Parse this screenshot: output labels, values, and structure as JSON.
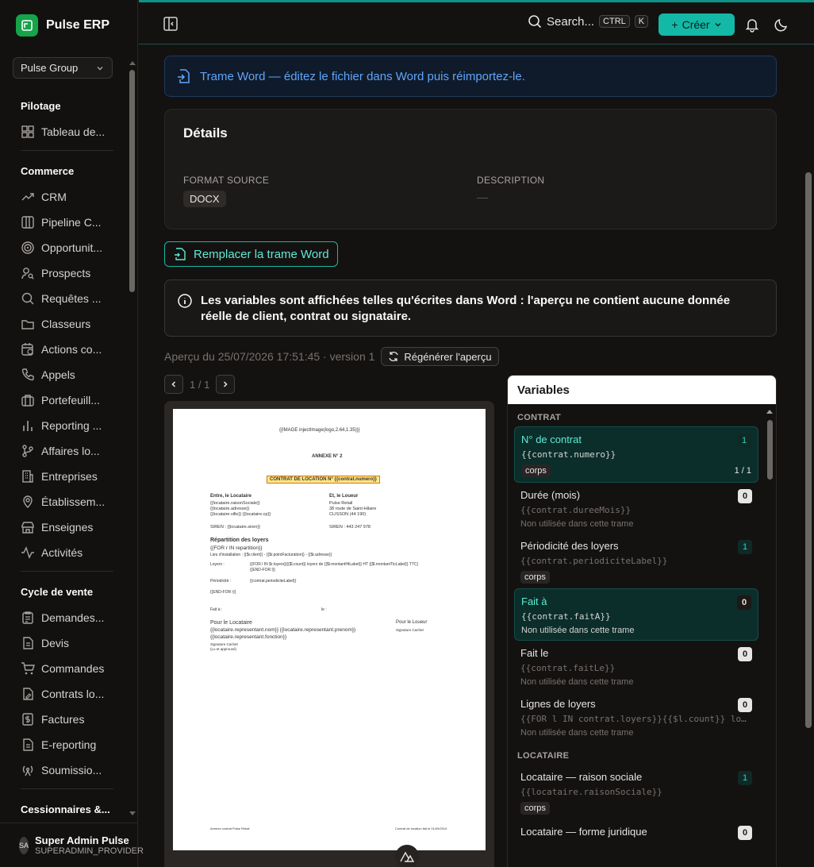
{
  "brand": {
    "name": "Pulse ERP"
  },
  "org": {
    "label": "Pulse Group"
  },
  "nav": {
    "pilotage": {
      "title": "Pilotage",
      "items": [
        "Tableau de..."
      ]
    },
    "commerce": {
      "title": "Commerce",
      "items": [
        "CRM",
        "Pipeline C...",
        "Opportunit...",
        "Prospects",
        "Requêtes ...",
        "Classeurs",
        "Actions co...",
        "Appels",
        "Portefeuill...",
        "Reporting ...",
        "Affaires lo...",
        "Entreprises",
        "Établissem...",
        "Enseignes",
        "Activités"
      ]
    },
    "cycle": {
      "title": "Cycle de vente",
      "items": [
        "Demandes...",
        "Devis",
        "Commandes",
        "Contrats lo...",
        "Factures",
        "E-reporting",
        "Soumissio..."
      ]
    },
    "cessionnaires": {
      "title": "Cessionnaires &..."
    }
  },
  "user": {
    "initials": "SA",
    "name": "Super Admin Pulse",
    "role": "SUPERADMIN_PROVIDER"
  },
  "topbar": {
    "search": "Search...",
    "kbd1": "CTRL",
    "kbd2": "K",
    "create": "Créer"
  },
  "banner": "Trame Word — éditez le fichier dans Word puis réimportez-le.",
  "details": {
    "title": "Détails",
    "format_label": "FORMAT SOURCE",
    "format_value": "DOCX",
    "desc_label": "DESCRIPTION",
    "desc_value": "—"
  },
  "replace_button": "Remplacer la trame Word",
  "info": "Les variables sont affichées telles qu'écrites dans Word : l'aperçu ne contient aucune donnée réelle de client, contrat ou signataire.",
  "preview": {
    "meta": "Aperçu du 25/07/2026 17:51:45 · version 1",
    "regen": "Régénérer l'aperçu",
    "page": "1 / 1"
  },
  "doc": {
    "image": "{{IMAGE injectImage(logo,2.64,1.35)}}",
    "annexe": "ANNEXE N° 2",
    "title": "CONTRAT DE LOCATION N° {{contrat.numero}}",
    "loc_head": "Entre, le Locataire",
    "loc1": "{{locataire.raisonSociale}}",
    "loc2": "{{locataire.adresse}}",
    "loc3": "{{locataire.ville}} {{locataire.cp}}",
    "lou_head": "Et, le Loueur",
    "lou1": "Pulse Retail",
    "lou2": "38 route de Saint-Hilaire",
    "lou3": "CLISSON (44 190)",
    "siren_l": "SIREN : {{locataire.siren}}",
    "siren_r": "SIREN : 443 247 978",
    "rep_head": "Répartition des loyers",
    "for": "{{FOR r IN repartition}}",
    "lieu": "Lieu d'installation : {{$r.client}} - {{$r.pointFacturation}} - {{$r.adresse}}",
    "loyers_l": "Loyers :",
    "loyers_v": "{{FOR l IN $r.loyers}}{{$l.count}} loyers de {{$l.montantHtLabel}} HT {{$l.montantTtcLabel}} TTC}",
    "endfor1": "{{END-FOR l}}",
    "period_l": "Périodicité :",
    "period_v": "{{contrat.periodiciteLabel}}",
    "endfor2": "{{END-FOR r}}",
    "fait_a": "Fait à :",
    "le": "le :",
    "pour_loc": "Pour le Locataire",
    "rep1": "{{locataire.representant.nom}} {{locataire.representant.prenom}}",
    "rep2": "{{locataire.representant.fonction}}",
    "sig1": "Signature Cachet",
    "sig2": "(Lu et approuvé)",
    "pour_lou": "Pour le Loueur",
    "sig3": "Signature Cachet",
    "foot_l": "Annexe contrat Pulse Retail",
    "foot_r": "Contrat de location fait le 01/09/2019"
  },
  "variables": {
    "title": "Variables",
    "groups": [
      {
        "name": "CONTRAT",
        "items": [
          {
            "name": "N° de contrat",
            "code": "{{contrat.numero}}",
            "count": "1",
            "chip": "corps",
            "ratio": "1 / 1"
          },
          {
            "name": "Durée (mois)",
            "code": "{{contrat.dureeMois}}",
            "count": "0",
            "unused": "Non utilisée dans cette trame"
          },
          {
            "name": "Périodicité des loyers",
            "code": "{{contrat.periodiciteLabel}}",
            "count": "1",
            "chip": "corps"
          },
          {
            "name": "Fait à",
            "code": "{{contrat.faitA}}",
            "count": "0",
            "unused": "Non utilisée dans cette trame"
          },
          {
            "name": "Fait le",
            "code": "{{contrat.faitLe}}",
            "count": "0",
            "unused": "Non utilisée dans cette trame"
          },
          {
            "name": "Lignes de loyers",
            "code": "{{FOR l IN contrat.loyers}}{{$l.count}} loyers de",
            "count": "0",
            "unused": "Non utilisée dans cette trame"
          }
        ]
      },
      {
        "name": "LOCATAIRE",
        "items": [
          {
            "name": "Locataire — raison sociale",
            "code": "{{locataire.raisonSociale}}",
            "count": "1",
            "chip": "corps"
          },
          {
            "name": "Locataire — forme juridique",
            "count": "0"
          }
        ]
      }
    ]
  }
}
